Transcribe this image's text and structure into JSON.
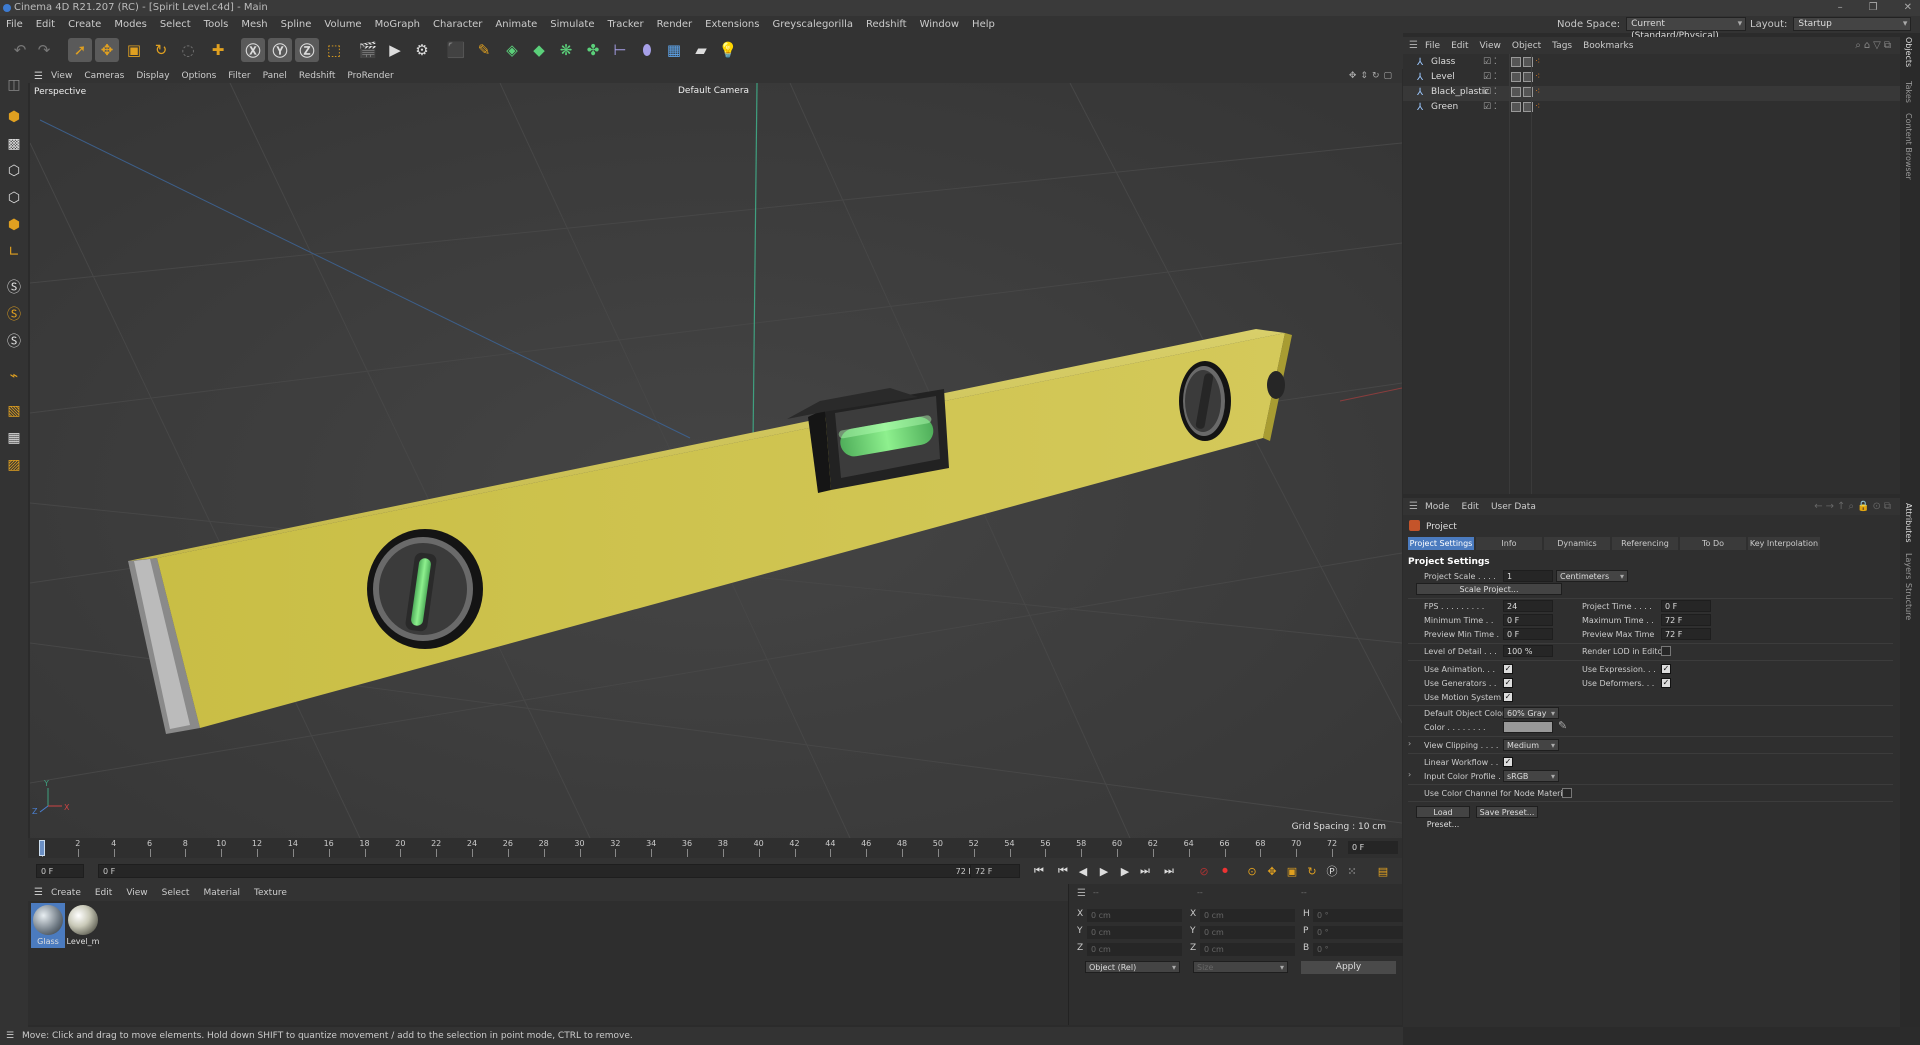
{
  "window": {
    "title": "Cinema 4D R21.207 (RC) - [Spirit Level.c4d] - Main",
    "controls": [
      "–",
      "❐",
      "✕"
    ]
  },
  "menu": [
    "File",
    "Edit",
    "Create",
    "Modes",
    "Select",
    "Tools",
    "Mesh",
    "Spline",
    "Volume",
    "MoGraph",
    "Character",
    "Animate",
    "Simulate",
    "Tracker",
    "Render",
    "Extensions",
    "Greyscalegorilla",
    "Redshift",
    "Window",
    "Help"
  ],
  "node_space": {
    "label": "Node Space:",
    "value": "Current (Standard/Physical)"
  },
  "layout": {
    "label": "Layout:",
    "value": "Startup"
  },
  "viewport": {
    "menu": [
      "View",
      "Cameras",
      "Display",
      "Options",
      "Filter",
      "Panel",
      "Redshift",
      "ProRender"
    ],
    "name": "Perspective",
    "camera": "Default Camera",
    "grid_spacing": "Grid Spacing : 10 cm",
    "axis_y": "Y",
    "axis_x": "X",
    "axis_z": "Z"
  },
  "timeline": {
    "ticks": [
      "0",
      "2",
      "4",
      "6",
      "8",
      "10",
      "12",
      "14",
      "16",
      "18",
      "20",
      "22",
      "24",
      "26",
      "28",
      "30",
      "32",
      "34",
      "36",
      "38",
      "40",
      "42",
      "44",
      "46",
      "48",
      "50",
      "52",
      "54",
      "56",
      "58",
      "60",
      "62",
      "64",
      "66",
      "68",
      "70",
      "72"
    ],
    "current_frame": "0 F",
    "start": "0 F",
    "range_start": "0 F",
    "range_end": "72 F",
    "end": "72 F"
  },
  "materials": {
    "menu": [
      "Create",
      "Edit",
      "View",
      "Select",
      "Material",
      "Texture"
    ],
    "items": [
      {
        "name": "Glass",
        "color": "#9aa5b0"
      },
      {
        "name": "Level_m",
        "color": "#c9c9b8"
      }
    ]
  },
  "coords": {
    "headers": [
      "--",
      "--",
      "--"
    ],
    "rows": [
      {
        "a": "X",
        "av": "0 cm",
        "b": "X",
        "bv": "0 cm",
        "c": "H",
        "cv": "0 °"
      },
      {
        "a": "Y",
        "av": "0 cm",
        "b": "Y",
        "bv": "0 cm",
        "c": "P",
        "cv": "0 °"
      },
      {
        "a": "Z",
        "av": "0 cm",
        "b": "Z",
        "bv": "0 cm",
        "c": "B",
        "cv": "0 °"
      }
    ],
    "mode": "Object (Rel)",
    "size": "Size",
    "apply": "Apply"
  },
  "status": "Move: Click and drag to move elements. Hold down SHIFT to quantize movement / add to the selection in point mode, CTRL to remove.",
  "objects": {
    "menu": [
      "File",
      "Edit",
      "View",
      "Object",
      "Tags",
      "Bookmarks"
    ],
    "items": [
      {
        "name": "Glass"
      },
      {
        "name": "Level"
      },
      {
        "name": "Black_plastic"
      },
      {
        "name": "Green"
      }
    ]
  },
  "side_tabs": [
    "Objects",
    "Takes",
    "Content Browser",
    "Attributes",
    "Layers",
    "Structure"
  ],
  "attributes": {
    "menu": [
      "Mode",
      "Edit",
      "User Data"
    ],
    "title": "Project",
    "tabs": [
      "Project Settings",
      "Info",
      "Dynamics",
      "Referencing",
      "To Do",
      "Key Interpolation"
    ],
    "section": "Project Settings",
    "project_scale_label": "Project Scale . . . .",
    "project_scale": "1",
    "project_scale_unit": "Centimeters",
    "scale_project": "Scale Project...",
    "fps_label": "FPS . . . . . . . . .",
    "fps": "24",
    "project_time_label": "Project Time . . . .",
    "project_time": "0 F",
    "min_time_label": "Minimum Time . .",
    "min_time": "0 F",
    "max_time_label": "Maximum Time . .",
    "max_time": "72 F",
    "prev_min_label": "Preview Min Time .",
    "prev_min": "0 F",
    "prev_max_label": "Preview Max Time",
    "prev_max": "72 F",
    "lod_label": "Level of Detail . . .",
    "lod": "100 %",
    "render_lod_label": "Render LOD in Editor",
    "use_animation_label": "Use Animation. . .",
    "use_expression_label": "Use Expression. . .",
    "use_generators_label": "Use Generators . .",
    "use_deformers_label": "Use Deformers. . .",
    "use_motion_label": "Use Motion System",
    "default_color_label": "Default Object Color",
    "default_color": "60% Gray",
    "color_label": "Color . . . . . . . .",
    "view_clipping_label": "View Clipping . . . .",
    "view_clipping": "Medium",
    "linear_workflow_label": "Linear Workflow . .",
    "input_profile_label": "Input Color Profile .",
    "input_profile": "sRGB",
    "color_channel_label": "Use Color Channel for Node Material",
    "load_preset": "Load Preset...",
    "save_preset": "Save Preset..."
  }
}
